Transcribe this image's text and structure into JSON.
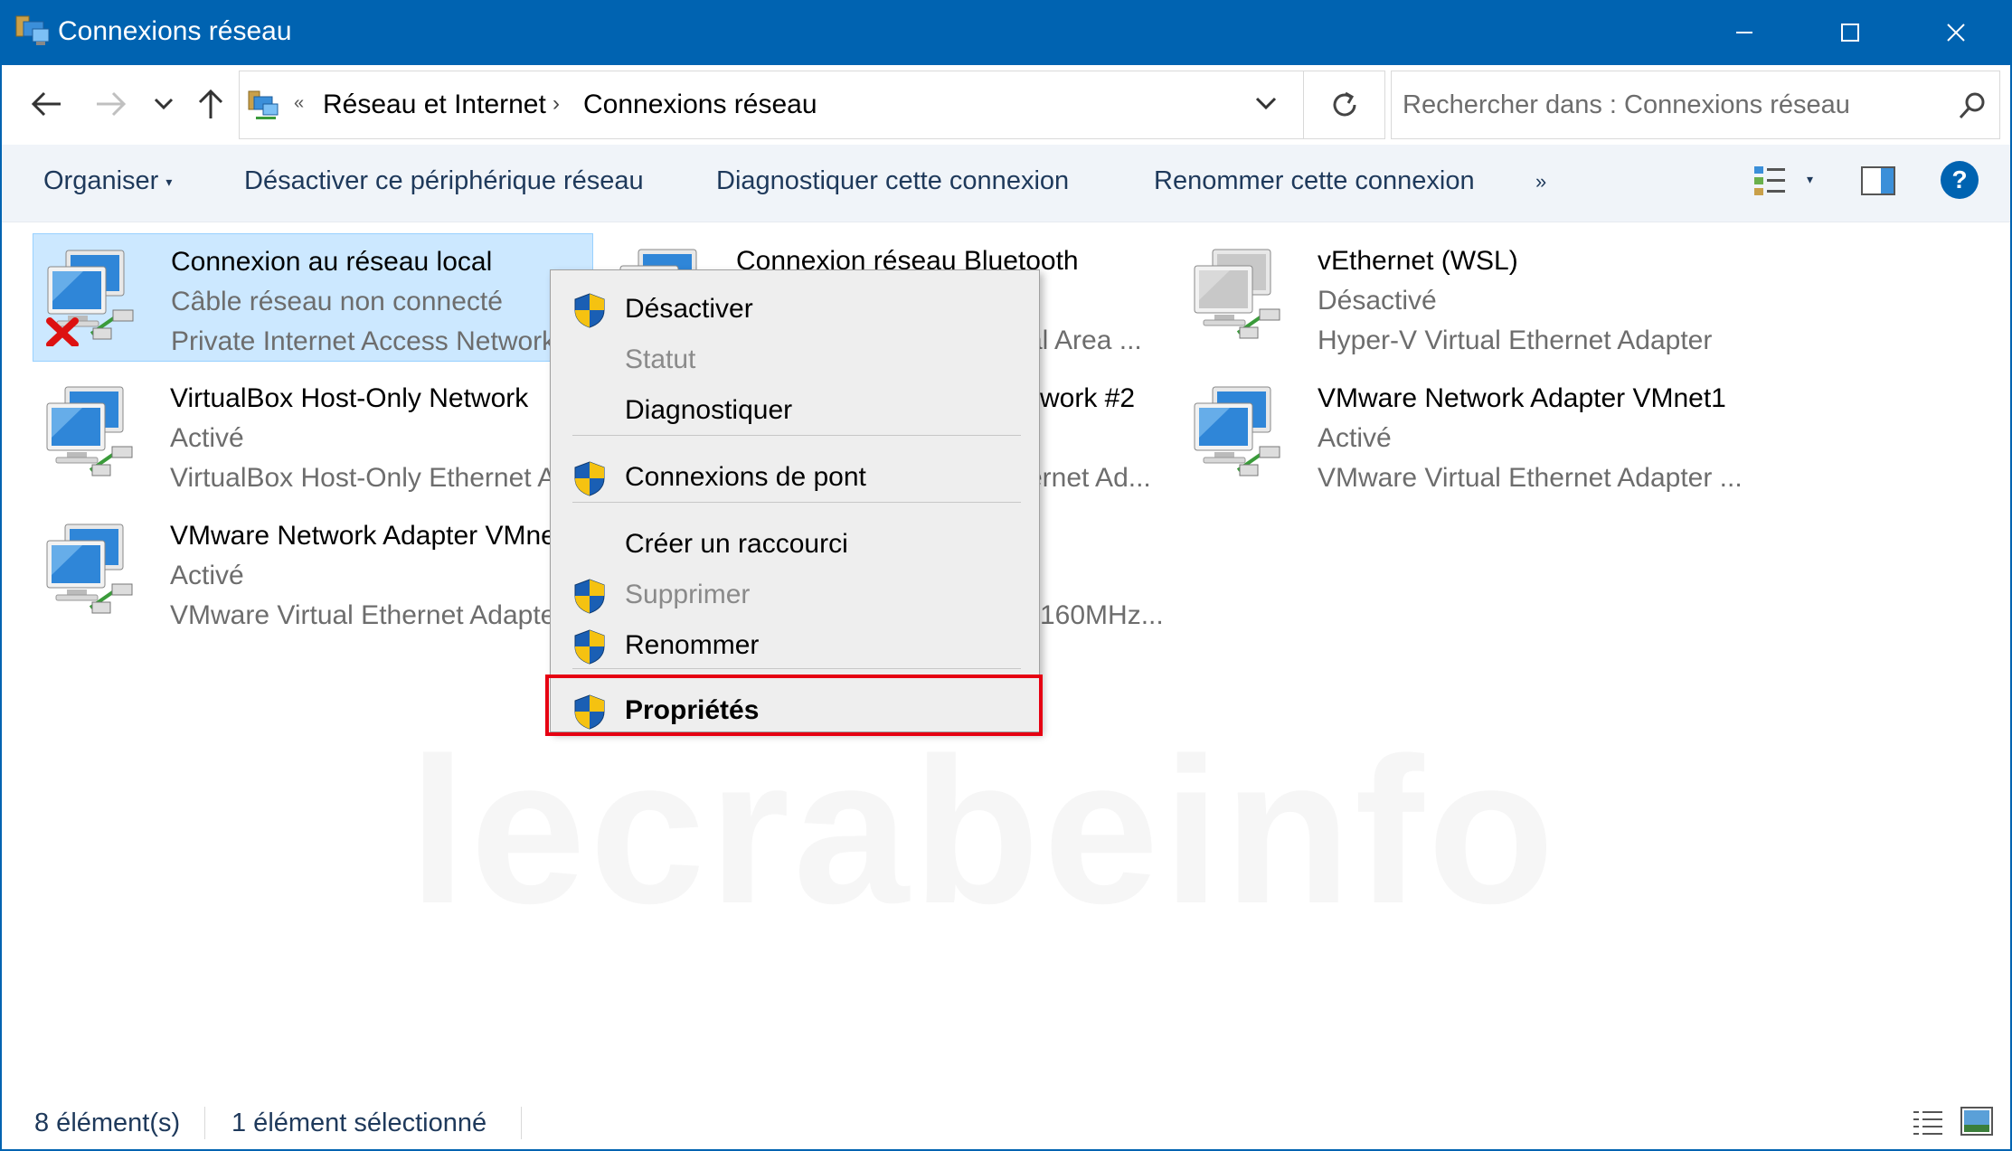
{
  "window": {
    "title": "Connexions réseau",
    "accent_color": "#0063b1",
    "icons": {
      "minimize": "minimize-icon",
      "maximize": "maximize-icon",
      "close": "close-icon"
    }
  },
  "navigation": {
    "back_icon": "arrow-left-icon",
    "forward_icon": "arrow-right-icon",
    "recent_icon": "chevron-down-icon",
    "up_icon": "arrow-up-icon"
  },
  "address": {
    "overflow_glyph": "«",
    "separator": "›",
    "crumbs": [
      "Réseau et Internet",
      "Connexions réseau"
    ]
  },
  "search": {
    "placeholder": "Rechercher dans : Connexions réseau"
  },
  "commands": {
    "organize": "Organiser",
    "disable": "Désactiver ce périphérique réseau",
    "diagnose": "Diagnostiquer cette connexion",
    "rename": "Renommer cette connexion",
    "more": "»",
    "help": "?"
  },
  "connections": [
    {
      "name": "Connexion au réseau local",
      "status": "Câble réseau non connecté",
      "device": "Private Internet Access Network",
      "selected": true,
      "state": "disconnected"
    },
    {
      "name": "Connexion réseau Bluetooth",
      "status": "",
      "device": "al Area ...",
      "selected": false,
      "state": "normal"
    },
    {
      "name": "vEthernet (WSL)",
      "status": "Désactivé",
      "device": "Hyper-V Virtual Ethernet Adapter",
      "selected": false,
      "state": "disabled"
    },
    {
      "name": "VirtualBox Host-Only Network",
      "status": "Activé",
      "device": "VirtualBox Host-Only Ethernet Ad",
      "selected": false,
      "state": "normal"
    },
    {
      "name": "work #2",
      "status": "",
      "device": "ernet Ad...",
      "selected": false,
      "state": "normal"
    },
    {
      "name": "VMware Network Adapter VMnet1",
      "status": "Activé",
      "device": "VMware Virtual Ethernet Adapter ...",
      "selected": false,
      "state": "normal"
    },
    {
      "name": "VMware Network Adapter VMne",
      "status": "Activé",
      "device": "VMware Virtual Ethernet Adapte",
      "selected": false,
      "state": "normal"
    },
    {
      "name": "",
      "status": "",
      "device": "160MHz...",
      "selected": false,
      "state": "normal"
    }
  ],
  "context_menu": {
    "items": [
      {
        "label": "Désactiver",
        "shield": true,
        "enabled": true,
        "bold": false
      },
      {
        "label": "Statut",
        "shield": false,
        "enabled": false,
        "bold": false
      },
      {
        "label": "Diagnostiquer",
        "shield": false,
        "enabled": true,
        "bold": false
      },
      {
        "label": "Connexions de pont",
        "shield": true,
        "enabled": true,
        "bold": false
      },
      {
        "label": "Créer un raccourci",
        "shield": false,
        "enabled": true,
        "bold": false
      },
      {
        "label": "Supprimer",
        "shield": true,
        "enabled": false,
        "bold": false
      },
      {
        "label": "Renommer",
        "shield": true,
        "enabled": true,
        "bold": false
      },
      {
        "label": "Propriétés",
        "shield": true,
        "enabled": true,
        "bold": true
      }
    ],
    "highlight_color": "#e60012"
  },
  "watermark": "lecrabeinfo",
  "statusbar": {
    "count": "8 élément(s)",
    "selection": "1 élément sélectionné"
  }
}
